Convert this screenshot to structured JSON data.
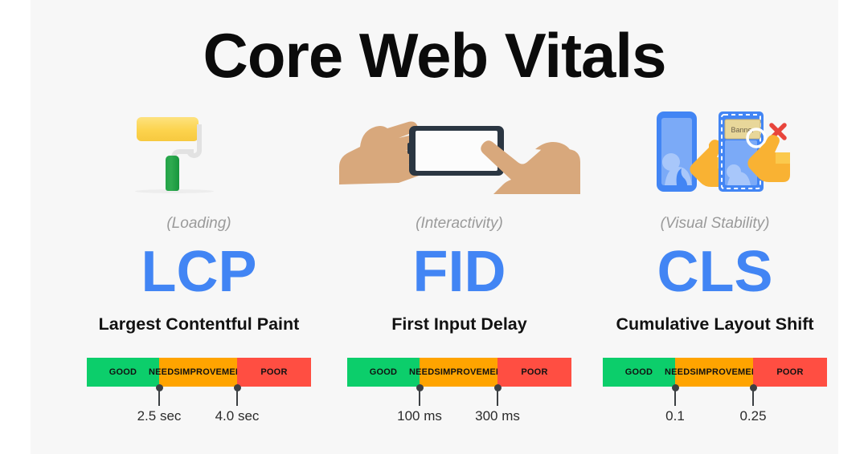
{
  "page": {
    "title": "Core Web Vitals",
    "background": "#f7f7f7",
    "accent": "#4285f4"
  },
  "legend_colors": {
    "good": "#0cce6b",
    "needs_improvement": "#ffa400",
    "poor": "#ff4e42"
  },
  "bar_labels": {
    "good": "GOOD",
    "needs_improvement_line1": "NEEDS",
    "needs_improvement_line2": "IMPROVEMENT",
    "poor": "POOR"
  },
  "metrics": [
    {
      "icon": "paint-roller-icon",
      "category": "(Loading)",
      "acronym": "LCP",
      "name": "Largest Contentful Paint",
      "thresholds": [
        "2.5 sec",
        "4.0 sec"
      ]
    },
    {
      "icon": "hands-tapping-phone-icon",
      "category": "(Interactivity)",
      "acronym": "FID",
      "name": "First Input Delay",
      "thresholds": [
        "100 ms",
        "300 ms"
      ]
    },
    {
      "icon": "layout-shift-phones-icon",
      "category": "(Visual Stability)",
      "acronym": "CLS",
      "name": "Cumulative Layout Shift",
      "thresholds": [
        "0.1",
        "0.25"
      ]
    }
  ],
  "cls_icon": {
    "banner_label": "Banner"
  }
}
